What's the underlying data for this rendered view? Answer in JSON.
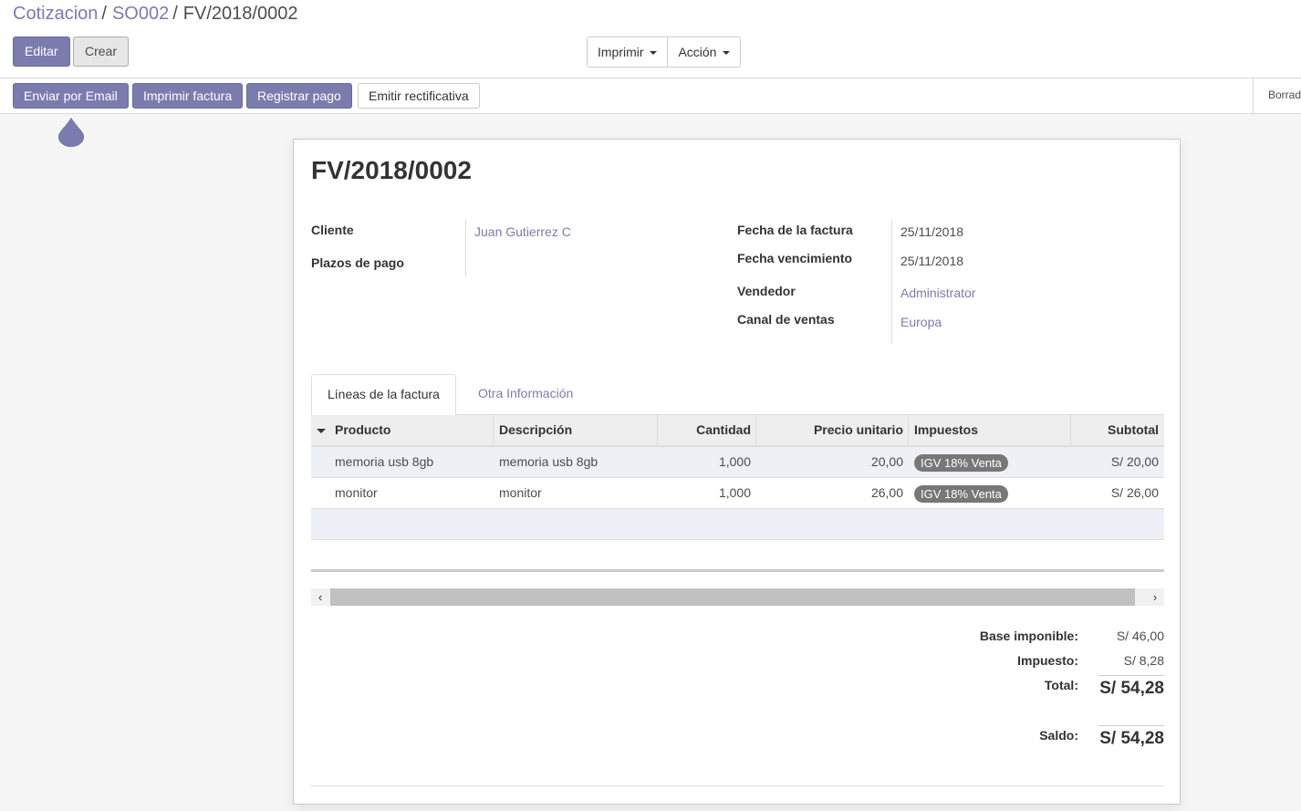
{
  "breadcrumb": {
    "items": [
      "Cotizacion",
      "SO002"
    ],
    "current": "FV/2018/0002",
    "separator": "/"
  },
  "toolbar": {
    "edit_label": "Editar",
    "create_label": "Crear",
    "print_label": "Imprimir",
    "action_label": "Acción"
  },
  "statusbar": {
    "send_email_label": "Enviar por Email",
    "print_invoice_label": "Imprimir factura",
    "register_payment_label": "Registrar pago",
    "credit_note_label": "Emitir rectificativa",
    "state_label": "Borrad"
  },
  "invoice": {
    "number": "FV/2018/0002",
    "customer_label": "Cliente",
    "customer_value": "Juan Gutierrez C",
    "payment_terms_label": "Plazos de pago",
    "invoice_date_label": "Fecha de la factura",
    "invoice_date_value": "25/11/2018",
    "due_date_label": "Fecha vencimiento",
    "due_date_value": "25/11/2018",
    "salesperson_label": "Vendedor",
    "salesperson_value": "Administrator",
    "channel_label": "Canal de ventas",
    "channel_value": "Europa"
  },
  "tabs": [
    {
      "label": "Líneas de la factura",
      "active": true
    },
    {
      "label": "Otra Información",
      "active": false
    }
  ],
  "lines": {
    "headers": {
      "product": "Producto",
      "description": "Descripción",
      "quantity": "Cantidad",
      "unit_price": "Precio unitario",
      "taxes": "Impuestos",
      "subtotal": "Subtotal"
    },
    "rows": [
      {
        "product": "memoria usb 8gb",
        "description": "memoria usb 8gb",
        "quantity": "1,000",
        "unit_price": "20,00",
        "tax": "IGV 18% Venta",
        "subtotal": "S/ 20,00"
      },
      {
        "product": "monitor",
        "description": "monitor",
        "quantity": "1,000",
        "unit_price": "26,00",
        "tax": "IGV 18% Venta",
        "subtotal": "S/ 26,00"
      }
    ]
  },
  "totals": {
    "base_label": "Base imponible:",
    "base_value": "S/ 46,00",
    "tax_label": "Impuesto:",
    "tax_value": "S/ 8,28",
    "total_label": "Total:",
    "total_value": "S/ 54,28",
    "balance_label": "Saldo:",
    "balance_value": "S/ 54,28"
  },
  "colors": {
    "accent": "#7c7bad",
    "badge": "#777777",
    "row_highlight": "#eef0f6"
  },
  "icons": {
    "sort": "caret-down-icon",
    "scroll_left": "chevron-left-icon",
    "scroll_right": "chevron-right-icon"
  }
}
